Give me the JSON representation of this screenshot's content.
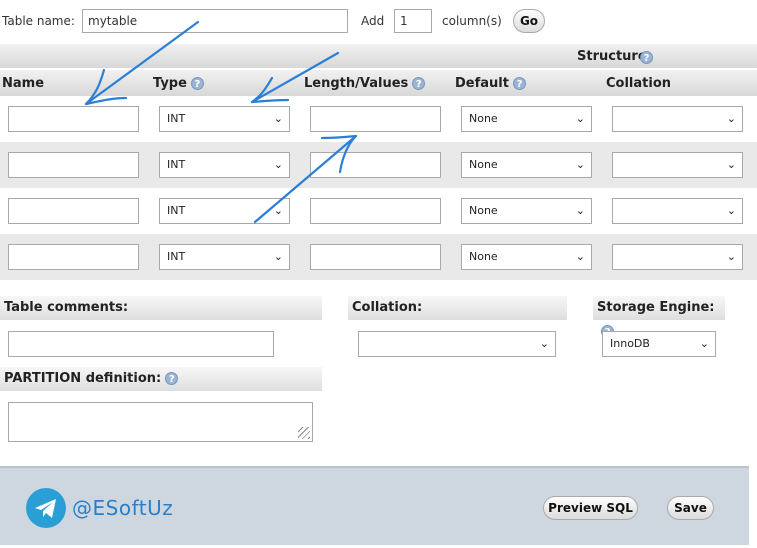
{
  "top": {
    "table_name_label": "Table name:",
    "table_name_value": "mytable",
    "add_label": "Add",
    "add_value": "1",
    "columns_label": "column(s)",
    "go_label": "Go"
  },
  "structure": {
    "title": "Structure",
    "help": "?",
    "headers": {
      "name": "Name",
      "type": "Type",
      "length": "Length/Values",
      "default": "Default",
      "collation": "Collation"
    },
    "rows": [
      {
        "name": "",
        "type": "INT",
        "length": "",
        "default": "None",
        "collation": ""
      },
      {
        "name": "",
        "type": "INT",
        "length": "",
        "default": "None",
        "collation": ""
      },
      {
        "name": "",
        "type": "INT",
        "length": "",
        "default": "None",
        "collation": ""
      },
      {
        "name": "",
        "type": "INT",
        "length": "",
        "default": "None",
        "collation": ""
      }
    ]
  },
  "options": {
    "table_comments_label": "Table comments:",
    "collation_label": "Collation:",
    "storage_engine_label": "Storage Engine:",
    "storage_engine_value": "InnoDB",
    "partition_label": "PARTITION definition:"
  },
  "footer": {
    "brand": "@ESoftUz",
    "preview_sql_label": "Preview SQL",
    "save_label": "Save"
  },
  "colors": {
    "arrow": "#2b7fd6",
    "footer_bg": "#ced7e0",
    "telegram": "#2a9fd6"
  },
  "icons": {
    "help": "question-circle-icon",
    "dropdown": "chevron-down-icon",
    "telegram": "telegram-icon"
  }
}
